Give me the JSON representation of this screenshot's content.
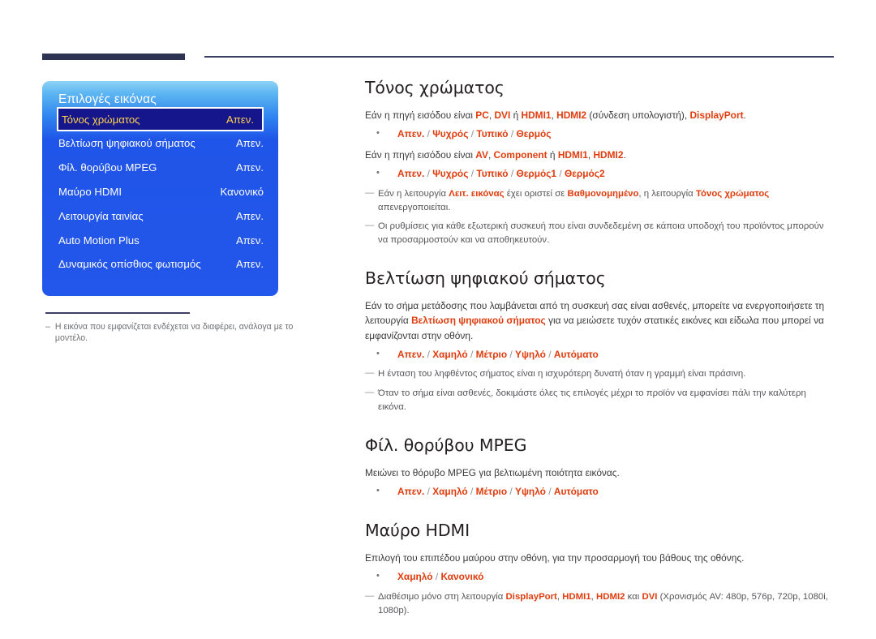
{
  "colors": {
    "accent_red": "#e03c0e",
    "osd_blue": "#2356ea",
    "osd_selected_bg": "#16168c",
    "osd_selected_text": "#ffd24d",
    "rule_navy": "#2e3354"
  },
  "osd": {
    "title": "Επιλογές εικόνας",
    "rows": [
      {
        "label": "Τόνος χρώματος",
        "value": "Απεν.",
        "selected": true
      },
      {
        "label": "Βελτίωση ψηφιακού σήματος",
        "value": "Απεν.",
        "selected": false
      },
      {
        "label": "Φίλ. θορύβου MPEG",
        "value": "Απεν.",
        "selected": false
      },
      {
        "label": "Μαύρο HDMI",
        "value": "Κανονικό",
        "selected": false
      },
      {
        "label": "Λειτουργία ταινίας",
        "value": "Απεν.",
        "selected": false
      },
      {
        "label": "Auto Motion Plus",
        "value": "Απεν.",
        "selected": false
      },
      {
        "label": "Δυναμικός οπίσθιος φωτισμός",
        "value": "Απεν.",
        "selected": false
      }
    ],
    "footnote_dash": "‒",
    "footnote": "Η εικόνα που εμφανίζεται ενδέχεται να διαφέρει, ανάλογα με το μοντέλο."
  },
  "sections": {
    "color_tone": {
      "title": "Τόνος χρώματος",
      "intro_pc": {
        "lead": "Εάν η πηγή εισόδου είναι ",
        "t1": "PC",
        "c1": ", ",
        "t2": "DVI",
        "c2": " ή ",
        "t3": "HDMI1",
        "c3": ", ",
        "t4": "HDMI2",
        "c4": " (σύνδεση υπολογιστή), ",
        "t5": "DisplayPort",
        "c5": "."
      },
      "options_pc": [
        "Απεν.",
        "Ψυχρός",
        "Τυπικό",
        "Θερμός"
      ],
      "intro_av": {
        "lead": "Εάν η πηγή εισόδου είναι ",
        "t1": "AV",
        "c1": ", ",
        "t2": "Component",
        "c2": " ή ",
        "t3": "HDMI1",
        "c3": ", ",
        "t4": "HDMI2",
        "c4": "."
      },
      "options_av": [
        "Απεν.",
        "Ψυχρός",
        "Τυπικό",
        "Θερμός1",
        "Θερμός2"
      ],
      "note1": {
        "p1": "Εάν η λειτουργία ",
        "h1": "Λειτ. εικόνας",
        "p2": " έχει οριστεί σε ",
        "h2": "Βαθμονομημένο",
        "p3": ", η λειτουργία ",
        "h3": "Τόνος χρώματος",
        "p4": " απενεργοποιείται."
      },
      "note2": "Οι ρυθμίσεις για κάθε εξωτερική συσκευή που είναι συνδεδεμένη σε κάποια υποδοχή του προϊόντος μπορούν να προσαρμοστούν και να αποθηκευτούν."
    },
    "digital_clean": {
      "title": "Βελτίωση ψηφιακού σήματος",
      "body": {
        "p1": "Εάν το σήμα μετάδοσης που λαμβάνεται από τη συσκευή σας είναι ασθενές, μπορείτε να ενεργοποιήσετε τη λειτουργία ",
        "h1": "Βελτίωση ψηφιακού σήματος",
        "p2": " για να μειώσετε τυχόν στατικές εικόνες και είδωλα που μπορεί να εμφανίζονται στην οθόνη."
      },
      "options": [
        "Απεν.",
        "Χαμηλό",
        "Μέτριο",
        "Υψηλό",
        "Αυτόματο"
      ],
      "note1": "Η ένταση του ληφθέντος σήματος είναι η ισχυρότερη δυνατή όταν η γραμμή είναι πράσινη.",
      "note2": "Όταν το σήμα είναι ασθενές, δοκιμάστε όλες τις επιλογές μέχρι το προϊόν να εμφανίσει πάλι την καλύτερη εικόνα."
    },
    "mpeg_filter": {
      "title": "Φίλ. θορύβου MPEG",
      "body": "Μειώνει το θόρυβο MPEG για βελτιωμένη ποιότητα εικόνας.",
      "options": [
        "Απεν.",
        "Χαμηλό",
        "Μέτριο",
        "Υψηλό",
        "Αυτόματο"
      ]
    },
    "hdmi_black": {
      "title": "Μαύρο HDMI",
      "body": "Επιλογή του επιπέδου μαύρου στην οθόνη, για την προσαρμογή του βάθους της οθόνης.",
      "options": [
        "Χαμηλό",
        "Κανονικό"
      ],
      "note": {
        "p1": "Διαθέσιμο μόνο στη λειτουργία ",
        "h1": "DisplayPort",
        "p2": ", ",
        "h2": "HDMI1",
        "p3": ", ",
        "h3": "HDMI2",
        "p4": " και ",
        "h4": "DVI",
        "p5": " (Χρονισμός AV: 480p, 576p, 720p, 1080i, 1080p)."
      }
    }
  },
  "glyphs": {
    "note_dash": "—",
    "bullet": "•",
    "slash": "/"
  }
}
